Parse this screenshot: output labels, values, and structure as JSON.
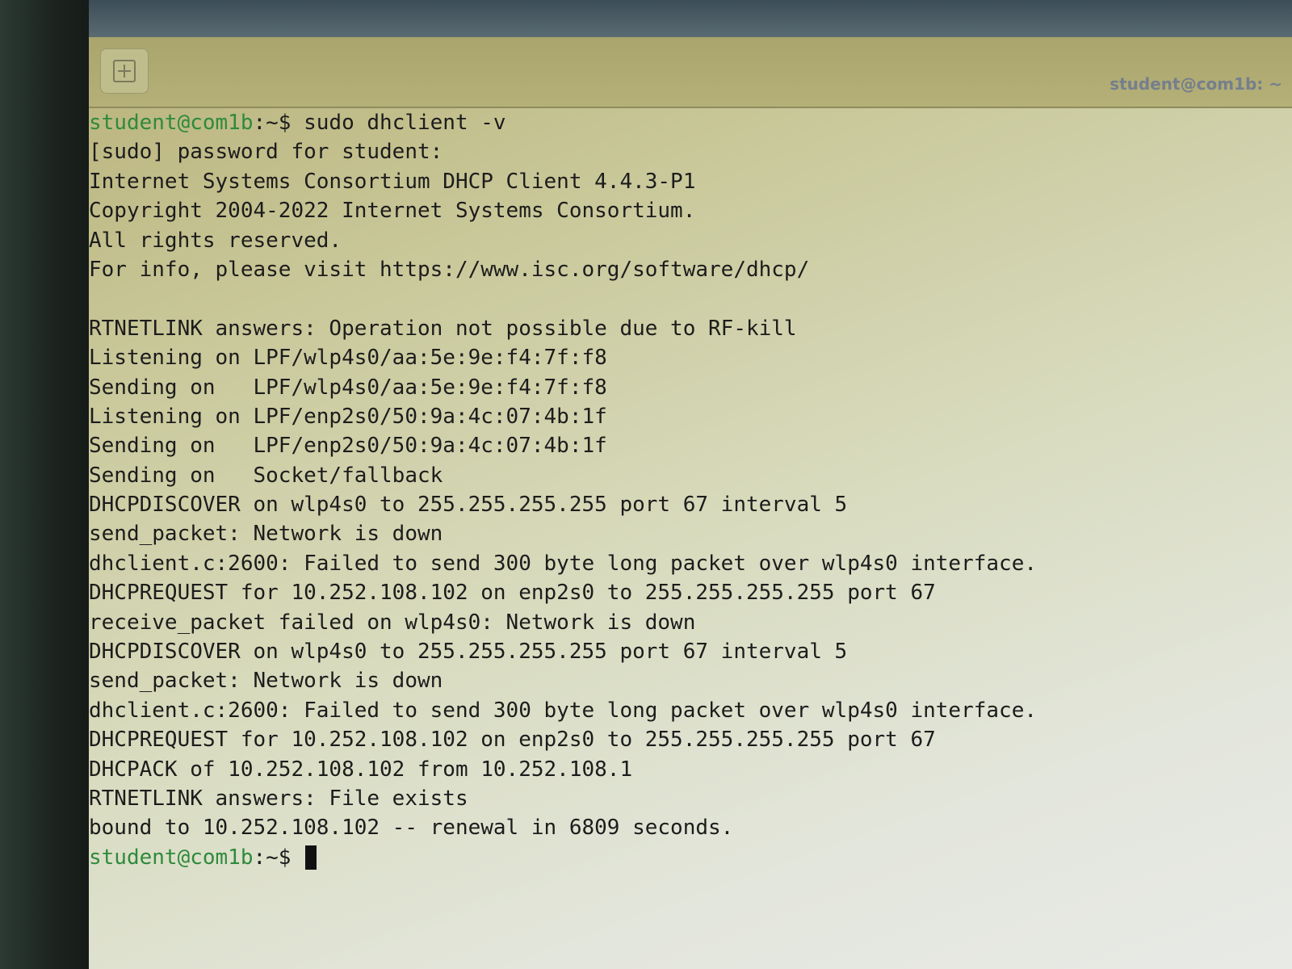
{
  "window": {
    "title": "student@com1b: ~"
  },
  "toolbar": {
    "new_tab_icon": "plus-square-icon"
  },
  "terminal": {
    "prompt": "student@com1b:~$ ",
    "lines": [
      "student@com1b:~$ sudo dhclient -v",
      "[sudo] password for student:",
      "Internet Systems Consortium DHCP Client 4.4.3-P1",
      "Copyright 2004-2022 Internet Systems Consortium.",
      "All rights reserved.",
      "For info, please visit https://www.isc.org/software/dhcp/",
      "",
      "RTNETLINK answers: Operation not possible due to RF-kill",
      "Listening on LPF/wlp4s0/aa:5e:9e:f4:7f:f8",
      "Sending on   LPF/wlp4s0/aa:5e:9e:f4:7f:f8",
      "Listening on LPF/enp2s0/50:9a:4c:07:4b:1f",
      "Sending on   LPF/enp2s0/50:9a:4c:07:4b:1f",
      "Sending on   Socket/fallback",
      "DHCPDISCOVER on wlp4s0 to 255.255.255.255 port 67 interval 5",
      "send_packet: Network is down",
      "dhclient.c:2600: Failed to send 300 byte long packet over wlp4s0 interface.",
      "DHCPREQUEST for 10.252.108.102 on enp2s0 to 255.255.255.255 port 67",
      "receive_packet failed on wlp4s0: Network is down",
      "DHCPDISCOVER on wlp4s0 to 255.255.255.255 port 67 interval 5",
      "send_packet: Network is down",
      "dhclient.c:2600: Failed to send 300 byte long packet over wlp4s0 interface.",
      "DHCPREQUEST for 10.252.108.102 on enp2s0 to 255.255.255.255 port 67",
      "DHCPACK of 10.252.108.102 from 10.252.108.1",
      "RTNETLINK answers: File exists",
      "bound to 10.252.108.102 -- renewal in 6809 seconds."
    ],
    "final_prompt_user": "student@com1b",
    "final_prompt_suffix": ":~$ "
  },
  "colors": {
    "prompt_green": "#2f8a3c",
    "text": "#1c1c1c"
  }
}
